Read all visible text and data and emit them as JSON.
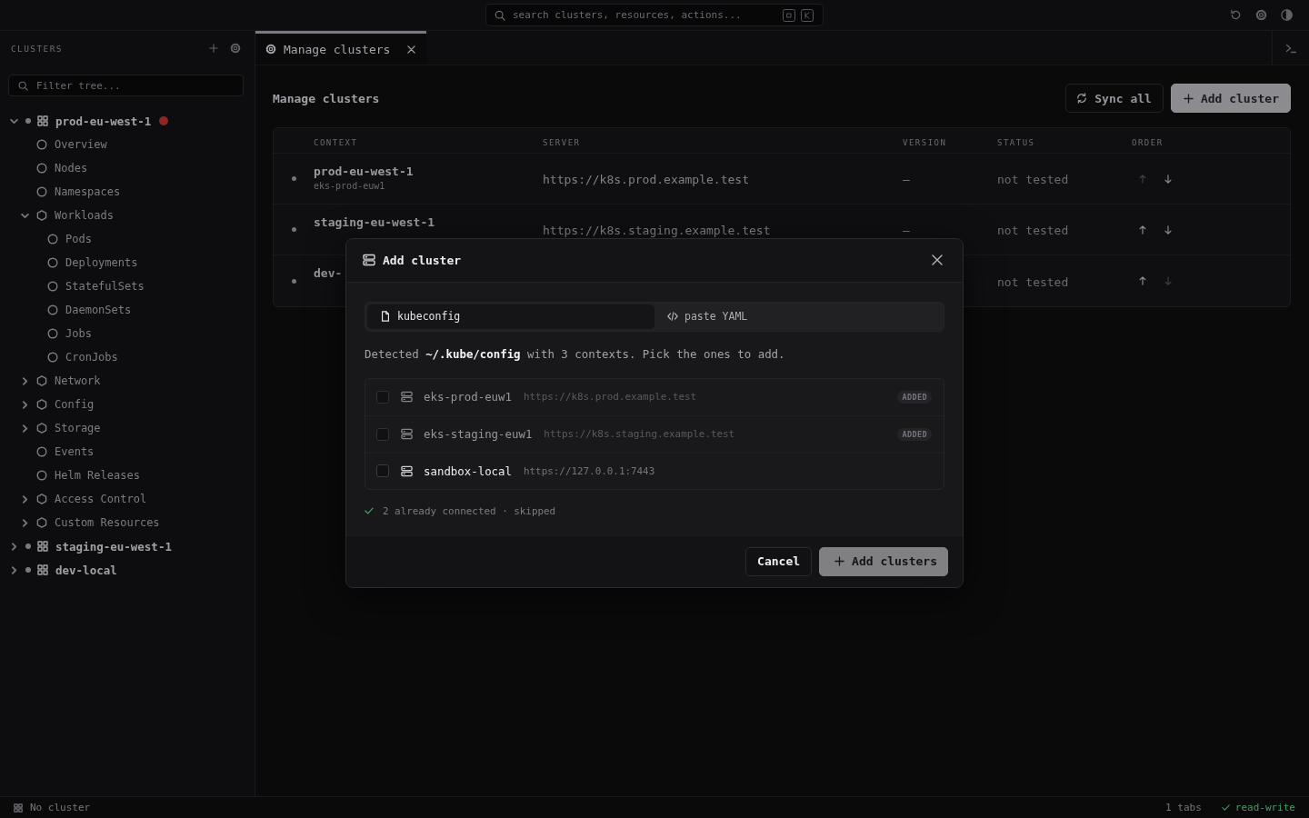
{
  "topbar": {
    "search": {
      "placeholder": "search clusters, resources, actions..."
    }
  },
  "sidebar": {
    "title": "CLUSTERS",
    "filter": {
      "placeholder": "Filter tree..."
    },
    "tree": [
      {
        "label": "prod-eu-west-1",
        "kind": "cluster",
        "expanded": true,
        "alert": true,
        "children": [
          {
            "label": "Overview",
            "kind": "resource"
          },
          {
            "label": "Nodes",
            "kind": "resource"
          },
          {
            "label": "Namespaces",
            "kind": "resource"
          },
          {
            "label": "Workloads",
            "kind": "group",
            "expanded": true,
            "children": [
              {
                "label": "Pods",
                "kind": "resource"
              },
              {
                "label": "Deployments",
                "kind": "resource"
              },
              {
                "label": "StatefulSets",
                "kind": "resource"
              },
              {
                "label": "DaemonSets",
                "kind": "resource"
              },
              {
                "label": "Jobs",
                "kind": "resource"
              },
              {
                "label": "CronJobs",
                "kind": "resource"
              }
            ]
          },
          {
            "label": "Network",
            "kind": "group",
            "expanded": false
          },
          {
            "label": "Config",
            "kind": "group",
            "expanded": false
          },
          {
            "label": "Storage",
            "kind": "group",
            "expanded": false
          },
          {
            "label": "Events",
            "kind": "resource"
          },
          {
            "label": "Helm Releases",
            "kind": "resource"
          },
          {
            "label": "Access Control",
            "kind": "group",
            "expanded": false
          },
          {
            "label": "Custom Resources",
            "kind": "group",
            "expanded": false
          }
        ]
      },
      {
        "label": "staging-eu-west-1",
        "kind": "cluster",
        "expanded": false,
        "alert": false
      },
      {
        "label": "dev-local",
        "kind": "cluster",
        "expanded": false,
        "alert": false
      }
    ]
  },
  "tabs": [
    {
      "label": "Manage clusters",
      "selected": true
    }
  ],
  "main": {
    "title": "Manage clusters",
    "buttons": [
      {
        "label": "Sync all",
        "kind": "secondary"
      },
      {
        "label": "Add cluster",
        "kind": "primary"
      }
    ],
    "table": {
      "columns": [
        "CONTEXT",
        "SERVER",
        "VERSION",
        "STATUS",
        "ORDER"
      ],
      "rows": [
        {
          "context": "prod-eu-west-1",
          "context_detail": "eks-prod-euw1",
          "server": "https://k8s.prod.example.test",
          "version": "—",
          "status": "not tested",
          "up_disabled": true,
          "down_disabled": false
        },
        {
          "context": "staging-eu-west-1",
          "server": "https://k8s.staging.example.test",
          "version": "—",
          "status": "not tested",
          "up_disabled": false,
          "down_disabled": false
        },
        {
          "context": "dev-",
          "status": "not tested",
          "up_disabled": false,
          "down_disabled": true
        }
      ]
    }
  },
  "status_bar": {
    "cluster": "No cluster",
    "tabs": "1 tabs",
    "mode": "read-write"
  },
  "dialog": {
    "title": "Add cluster",
    "sources": [
      {
        "label": "kubeconfig",
        "kind": "file",
        "selected": true
      },
      {
        "label": "paste YAML",
        "kind": "code",
        "selected": false
      }
    ],
    "message": "Detected **~/.kube/config** with 3 contexts. Pick the ones to add.",
    "contexts": [
      {
        "name": "eks-prod-euw1",
        "server": "https://k8s.prod.example.test",
        "checked": false,
        "disabled": true,
        "badge": "ADDED"
      },
      {
        "name": "eks-staging-euw1",
        "server": "https://k8s.staging.example.test",
        "checked": false,
        "disabled": true,
        "badge": "ADDED"
      },
      {
        "name": "sandbox-local",
        "server": "https://127.0.0.1:7443",
        "checked": false,
        "disabled": false
      }
    ],
    "note": "2 already connected · skipped",
    "buttons": [
      {
        "label": "Cancel",
        "kind": "secondary",
        "disabled": false
      },
      {
        "label": "Add clusters",
        "kind": "primary",
        "disabled": true
      }
    ]
  }
}
